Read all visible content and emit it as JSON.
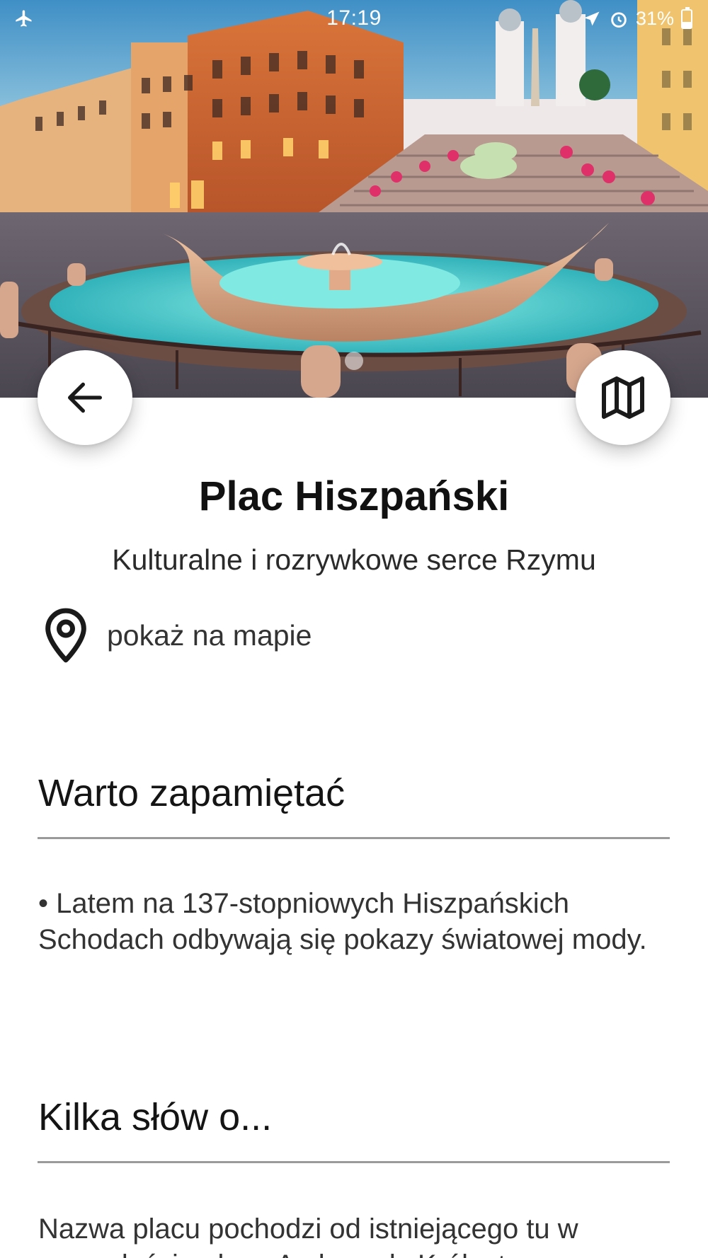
{
  "status_bar": {
    "time": "17:19",
    "battery": "31%",
    "battery_level": 0.31,
    "icons": [
      "airplane-mode-icon",
      "location-icon",
      "alarm-icon",
      "battery-icon"
    ]
  },
  "hero": {
    "image": "spanish-steps-photo",
    "carousel_pages": 1,
    "carousel_active": 0
  },
  "buttons": {
    "back_icon": "arrow-left-icon",
    "map_icon": "folded-map-icon"
  },
  "place": {
    "title": "Plac Hiszpański",
    "subtitle": "Kulturalne i rozrywkowe serce Rzymu",
    "map_link_label": "pokaż na mapie",
    "map_link_icon": "location-pin-icon"
  },
  "sections": [
    {
      "heading": "Warto zapamiętać",
      "body": "• Latem na 137-stopniowych Hiszpańskich Schodach odbywają się pokazy światowej mody."
    },
    {
      "heading": "Kilka słów o...",
      "body": "Nazwa placu pochodzi od istniejącego tu w przeszłości pałacu Ambasady Królestwa"
    }
  ],
  "colors": {
    "background": "#ffffff",
    "text_primary": "#111111",
    "text_secondary": "#333333",
    "divider": "#9a9a9a",
    "icon": "#1a1a1a"
  }
}
